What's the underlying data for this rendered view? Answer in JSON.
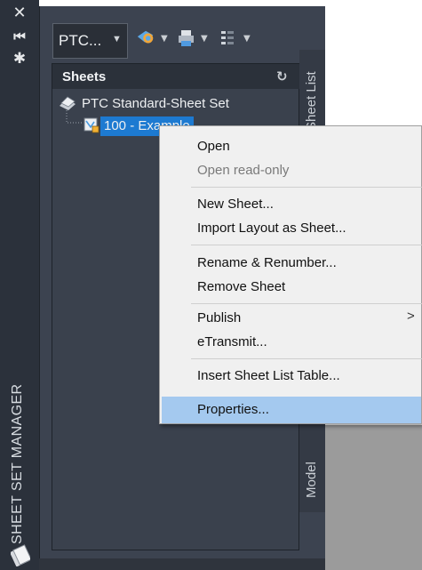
{
  "palette": {
    "title": "SHEET SET MANAGER",
    "dropdown_value": "PTC..."
  },
  "sheets_panel": {
    "header": "Sheets",
    "sheet_set": "PTC Standard-Sheet Set",
    "selected_sheet": "100 - Example"
  },
  "side_tabs": {
    "sheet_list": "Sheet List",
    "model": "Model"
  },
  "context_menu": {
    "items": [
      {
        "label": "Open"
      },
      {
        "label": "Open read-only"
      },
      {
        "label": "New Sheet..."
      },
      {
        "label": "Import Layout as Sheet..."
      },
      {
        "label": "Rename & Renumber..."
      },
      {
        "label": "Remove Sheet"
      },
      {
        "label": "Publish"
      },
      {
        "label": "eTransmit..."
      },
      {
        "label": "Insert Sheet List Table..."
      },
      {
        "label": "Properties..."
      }
    ],
    "submenu_arrow": ">"
  },
  "icons": {
    "close": "close-icon",
    "autohide": "autohide-icon",
    "properties": "gear-icon",
    "refresh": "refresh-icon"
  },
  "colors": {
    "selection": "#1d7ad1",
    "menu_highlight": "#a4c9ef",
    "panel": "#3c4350"
  }
}
